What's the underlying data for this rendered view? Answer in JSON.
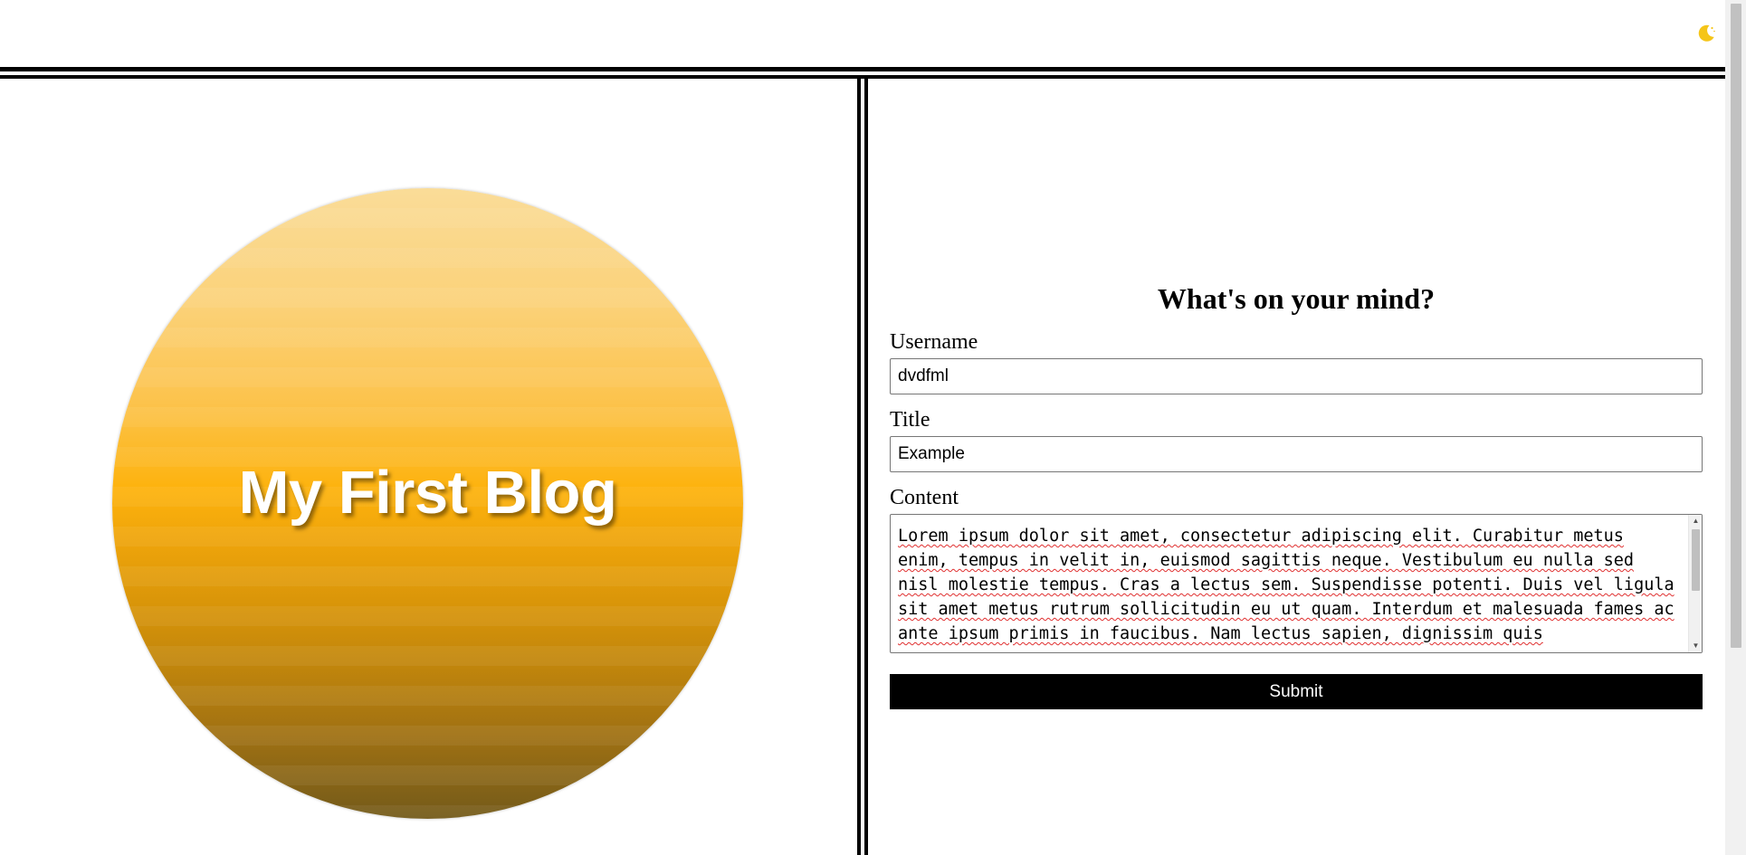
{
  "header": {
    "theme_icon": "moon-icon",
    "theme_icon_color": "#f5c518"
  },
  "hero": {
    "title": "My First Blog",
    "gradient_top": "#fadc98",
    "gradient_mid": "#fdb20c",
    "gradient_bottom": "#735a1a"
  },
  "form": {
    "heading": "What's on your mind?",
    "username_label": "Username",
    "username_value": "dvdfml",
    "title_label": "Title",
    "title_value": "Example",
    "content_label": "Content",
    "content_value": "Lorem ipsum dolor sit amet, consectetur adipiscing elit. Curabitur metus enim, tempus in velit in, euismod sagittis neque. Vestibulum eu nulla sed nisl molestie tempus. Cras a lectus sem. Suspendisse potenti. Duis vel ligula sit amet metus rutrum sollicitudin eu ut quam. Interdum et malesuada fames ac ante ipsum primis in faucibus. Nam lectus sapien, dignissim quis",
    "submit_label": "Submit"
  },
  "colors": {
    "rule": "#000000",
    "submit_bg": "#000000",
    "submit_text": "#ffffff"
  }
}
